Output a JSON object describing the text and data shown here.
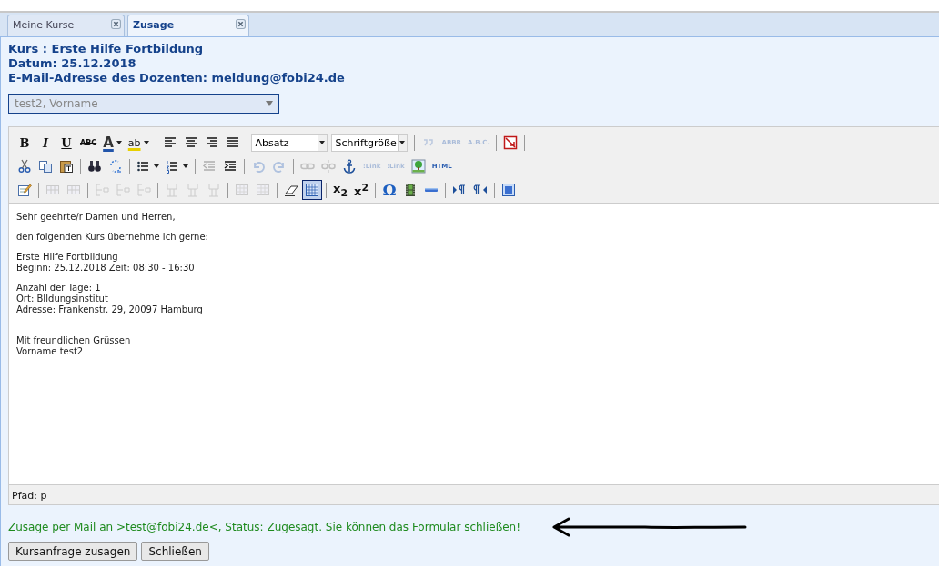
{
  "tabs": [
    {
      "label": "Meine Kurse",
      "selected": false
    },
    {
      "label": "Zusage",
      "selected": true
    }
  ],
  "header": {
    "course": "Kurs : Erste Hilfe Fortbildung",
    "date": "Datum: 25.12.2018",
    "email": "E-Mail-Adresse des Dozenten: meldung@fobi24.de"
  },
  "lecturer_select": {
    "value": "test2, Vorname"
  },
  "toolbar": [
    [
      {
        "kind": "bold",
        "label": "B",
        "disabled": false
      },
      {
        "kind": "italic",
        "label": "I",
        "disabled": false
      },
      {
        "kind": "underline",
        "label": "U",
        "disabled": false
      },
      {
        "kind": "strike",
        "label": "ABC",
        "disabled": false
      },
      {
        "kind": "color",
        "label": "A",
        "disabled": false
      },
      {
        "kind": "highlight",
        "label": "ab",
        "disabled": false
      },
      {
        "kind": "sep"
      },
      {
        "kind": "icon",
        "disabled": false,
        "active": false
      },
      {
        "kind": "icon",
        "disabled": false,
        "active": false
      },
      {
        "kind": "icon",
        "disabled": false,
        "active": false
      },
      {
        "kind": "icon",
        "disabled": false,
        "active": false
      },
      {
        "kind": "sep"
      },
      {
        "kind": "select",
        "label": "Absatz"
      },
      {
        "kind": "select",
        "label": "Schriftgröße"
      },
      {
        "kind": "sep"
      },
      {
        "kind": "icon",
        "disabled": true,
        "active": false
      },
      {
        "kind": "text",
        "label": "ABBR",
        "disabled": true
      },
      {
        "kind": "text",
        "label": "A.B.C.",
        "disabled": true
      },
      {
        "kind": "sep"
      },
      {
        "kind": "icon",
        "disabled": false,
        "active": false
      },
      {
        "kind": "sep"
      }
    ],
    [
      {
        "kind": "icon",
        "disabled": false,
        "active": false
      },
      {
        "kind": "icon",
        "disabled": false,
        "active": false
      },
      {
        "kind": "icon",
        "disabled": false,
        "active": false
      },
      {
        "kind": "sep"
      },
      {
        "kind": "icon",
        "disabled": false,
        "active": false
      },
      {
        "kind": "icon",
        "disabled": false,
        "active": false
      },
      {
        "kind": "sep"
      },
      {
        "kind": "icon",
        "disabled": false,
        "active": false
      },
      {
        "kind": "icon",
        "disabled": false,
        "active": false
      },
      {
        "kind": "sep"
      },
      {
        "kind": "icon",
        "disabled": true,
        "active": false
      },
      {
        "kind": "icon",
        "disabled": false,
        "active": false
      },
      {
        "kind": "sep"
      },
      {
        "kind": "icon",
        "disabled": true,
        "active": false
      },
      {
        "kind": "icon",
        "disabled": true,
        "active": false
      },
      {
        "kind": "sep"
      },
      {
        "kind": "icon",
        "disabled": true,
        "active": false
      },
      {
        "kind": "icon",
        "disabled": true,
        "active": false
      },
      {
        "kind": "icon",
        "disabled": false,
        "active": false
      },
      {
        "kind": "text",
        "label": ":Link",
        "disabled": true
      },
      {
        "kind": "text",
        "label": ":Link",
        "disabled": true
      },
      {
        "kind": "icon",
        "disabled": false,
        "active": false
      },
      {
        "kind": "text",
        "label": "HTML",
        "disabled": false
      }
    ],
    [
      {
        "kind": "icon",
        "disabled": false,
        "active": false
      },
      {
        "kind": "sep"
      },
      {
        "kind": "icon",
        "disabled": true,
        "active": false
      },
      {
        "kind": "icon",
        "disabled": true,
        "active": false
      },
      {
        "kind": "sep"
      },
      {
        "kind": "icon",
        "disabled": true,
        "active": false
      },
      {
        "kind": "icon",
        "disabled": true,
        "active": false
      },
      {
        "kind": "icon",
        "disabled": true,
        "active": false
      },
      {
        "kind": "sep"
      },
      {
        "kind": "icon",
        "disabled": true,
        "active": false
      },
      {
        "kind": "icon",
        "disabled": true,
        "active": false
      },
      {
        "kind": "icon",
        "disabled": true,
        "active": false
      },
      {
        "kind": "sep"
      },
      {
        "kind": "icon",
        "disabled": true,
        "active": false
      },
      {
        "kind": "icon",
        "disabled": true,
        "active": false
      },
      {
        "kind": "sep"
      },
      {
        "kind": "icon",
        "disabled": false,
        "active": false
      },
      {
        "kind": "icon",
        "disabled": false,
        "active": true
      },
      {
        "kind": "sep"
      },
      {
        "kind": "rich",
        "label": "x$_{2}$",
        "disabled": false
      },
      {
        "kind": "rich",
        "label": "x$^{2}$",
        "disabled": false
      },
      {
        "kind": "sep"
      },
      {
        "kind": "symbol",
        "label": "Ω",
        "disabled": false
      },
      {
        "kind": "icon",
        "disabled": false,
        "active": false
      },
      {
        "kind": "icon",
        "disabled": false,
        "active": false
      },
      {
        "kind": "sep"
      },
      {
        "kind": "icon",
        "disabled": false,
        "active": false
      },
      {
        "kind": "icon",
        "disabled": false,
        "active": false
      },
      {
        "kind": "sep"
      },
      {
        "kind": "icon",
        "disabled": false,
        "active": false
      }
    ]
  ],
  "editor_body": [
    [
      "Sehr geehrte/r Damen und Herren,"
    ],
    [
      "den folgenden Kurs übernehme ich gerne:"
    ],
    [
      "Erste Hilfe Fortbildung",
      "Beginn: 25.12.2018 Zeit: 08:30 - 16:30"
    ],
    [
      "Anzahl der Tage: 1",
      "Ort: BIldungsinstitut",
      "Adresse: Frankenstr. 29, 20097 Hamburg"
    ],
    [
      "Mit freundlichen Grüssen",
      "Vorname test2"
    ]
  ],
  "path_bar": "Pfad: p",
  "status_message": "Zusage per Mail an >test@fobi24.de<, Status: Zugesagt. Sie können das Formular schließen!",
  "buttons": [
    "Kursanfrage zusagen",
    "Schließen"
  ]
}
